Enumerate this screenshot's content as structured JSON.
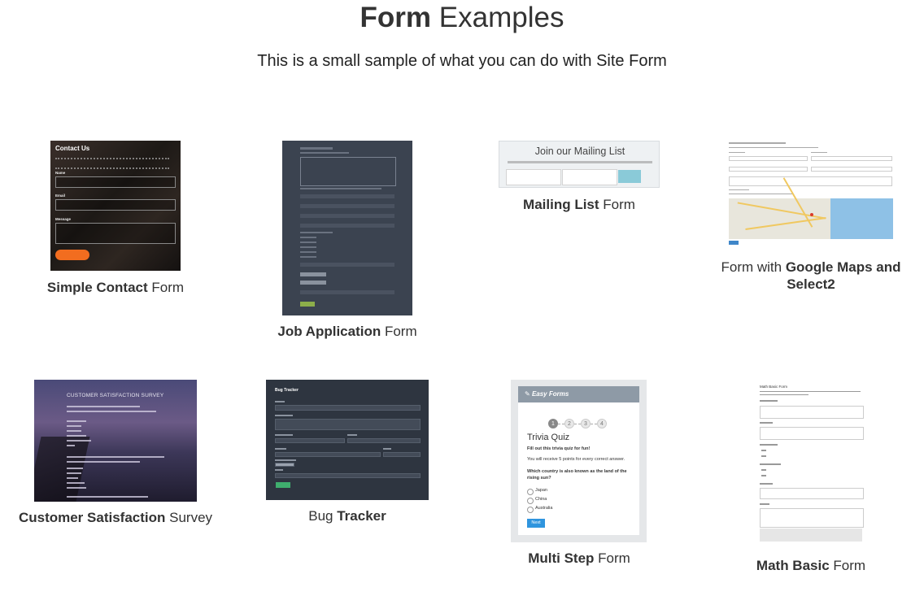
{
  "header": {
    "title_bold": "Form",
    "title_rest": " Examples",
    "subtitle": "This is a small sample of what you can do with Site Form"
  },
  "examples": [
    {
      "bold": "Simple Contact",
      "rest": " Form",
      "preview": {
        "heading": "Contact Us",
        "fields": [
          "Name",
          "Email",
          "Message"
        ]
      }
    },
    {
      "bold": "Job Application",
      "rest": " Form"
    },
    {
      "bold": "Mailing List",
      "rest": " Form",
      "preview": {
        "heading": "Join our Mailing List"
      }
    },
    {
      "pre": "Form with ",
      "bold": "Google Maps and Select2"
    },
    {
      "bold": "Customer Satisfaction",
      "rest": " Survey",
      "preview": {
        "heading": "CUSTOMER SATISFACTION SURVEY"
      }
    },
    {
      "pre": "Bug ",
      "bold": "Tracker",
      "preview": {
        "heading": "Bug Tracker"
      }
    },
    {
      "bold": "Multi Step",
      "rest": " Form",
      "preview": {
        "brand": "Easy Forms",
        "steps": [
          "1",
          "2",
          "3",
          "4"
        ],
        "quiz_title": "Trivia Quiz",
        "intro": "Fill out this trivia quiz for fun!",
        "note": "You will receive 5 points for every correct answer.",
        "question": "Which country is also known as the land of the rising sun?",
        "options": [
          "Japan",
          "China",
          "Australia"
        ],
        "button": "Next"
      }
    },
    {
      "bold": "Math Basic",
      "rest": " Form",
      "preview": {
        "heading": "Math Basic Form"
      }
    }
  ],
  "colors": {
    "contact_button": "#f26d1f",
    "job_button": "#8cae4a",
    "mailing_button": "#8acad8",
    "bug_button": "#3fae6e",
    "multi_next_button": "#2f95de"
  }
}
